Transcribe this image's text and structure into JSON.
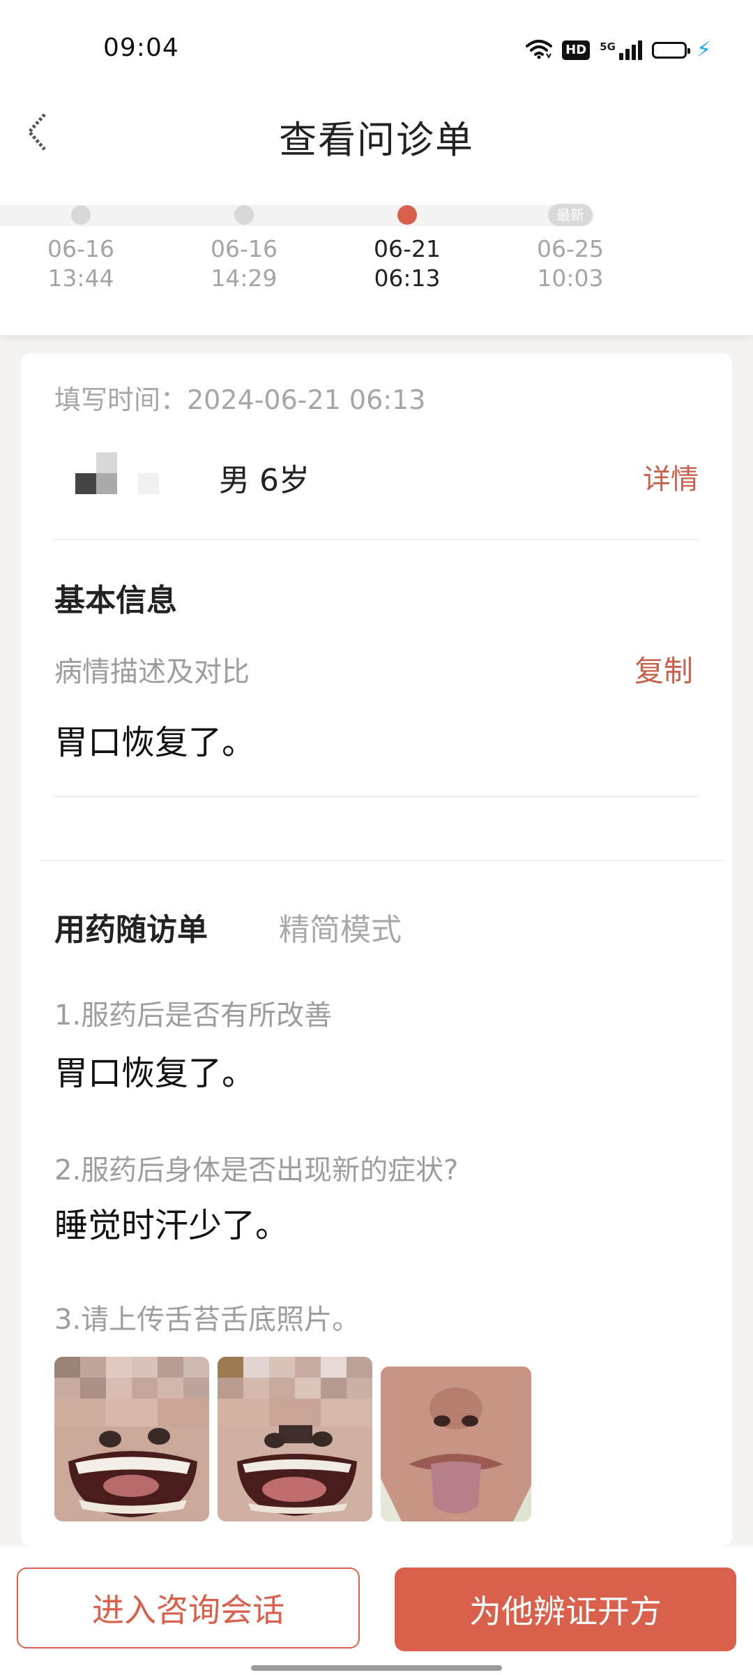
{
  "status_bar": {
    "time": "09:04",
    "hd": "HD",
    "network": "5G",
    "icons": [
      "wifi-icon",
      "hd-icon",
      "5g-signal-icon",
      "battery-icon",
      "charging-icon"
    ],
    "battery_level": 1.0,
    "battery_color": "#18a8f0"
  },
  "header": {
    "title": "查看问诊单",
    "back_icon": "back-arrow-icon"
  },
  "timeline": [
    {
      "date": "06-16",
      "time": "13:44",
      "state": "past"
    },
    {
      "date": "06-16",
      "time": "14:29",
      "state": "past"
    },
    {
      "date": "06-21",
      "time": "06:13",
      "state": "current"
    },
    {
      "date": "06-25",
      "time": "10:03",
      "state": "newest",
      "badge": "最新"
    }
  ],
  "record": {
    "fill_time": "填写时间：2024-06-21 06:13",
    "patient_info": "男 6岁",
    "detail_link": "详情"
  },
  "basic_info": {
    "title": "基本信息",
    "condition_label": "病情描述及对比",
    "copy_label": "复制",
    "condition_value": "胃口恢复了。"
  },
  "followup": {
    "title": "用药随访单",
    "mode_label": "精简模式",
    "questions": [
      {
        "q": "1.服药后是否有所改善",
        "a": "胃口恢复了。"
      },
      {
        "q": "2.服药后身体是否出现新的症状?",
        "a": "睡觉时汗少了。"
      },
      {
        "q": "3.请上传舌苔舌底照片。",
        "a": ""
      }
    ]
  },
  "actions": {
    "consult": "进入咨询会话",
    "prescribe": "为他辨证开方"
  },
  "colors": {
    "accent": "#d9604b",
    "link": "#c8614c",
    "background": "#f4f3f1"
  }
}
